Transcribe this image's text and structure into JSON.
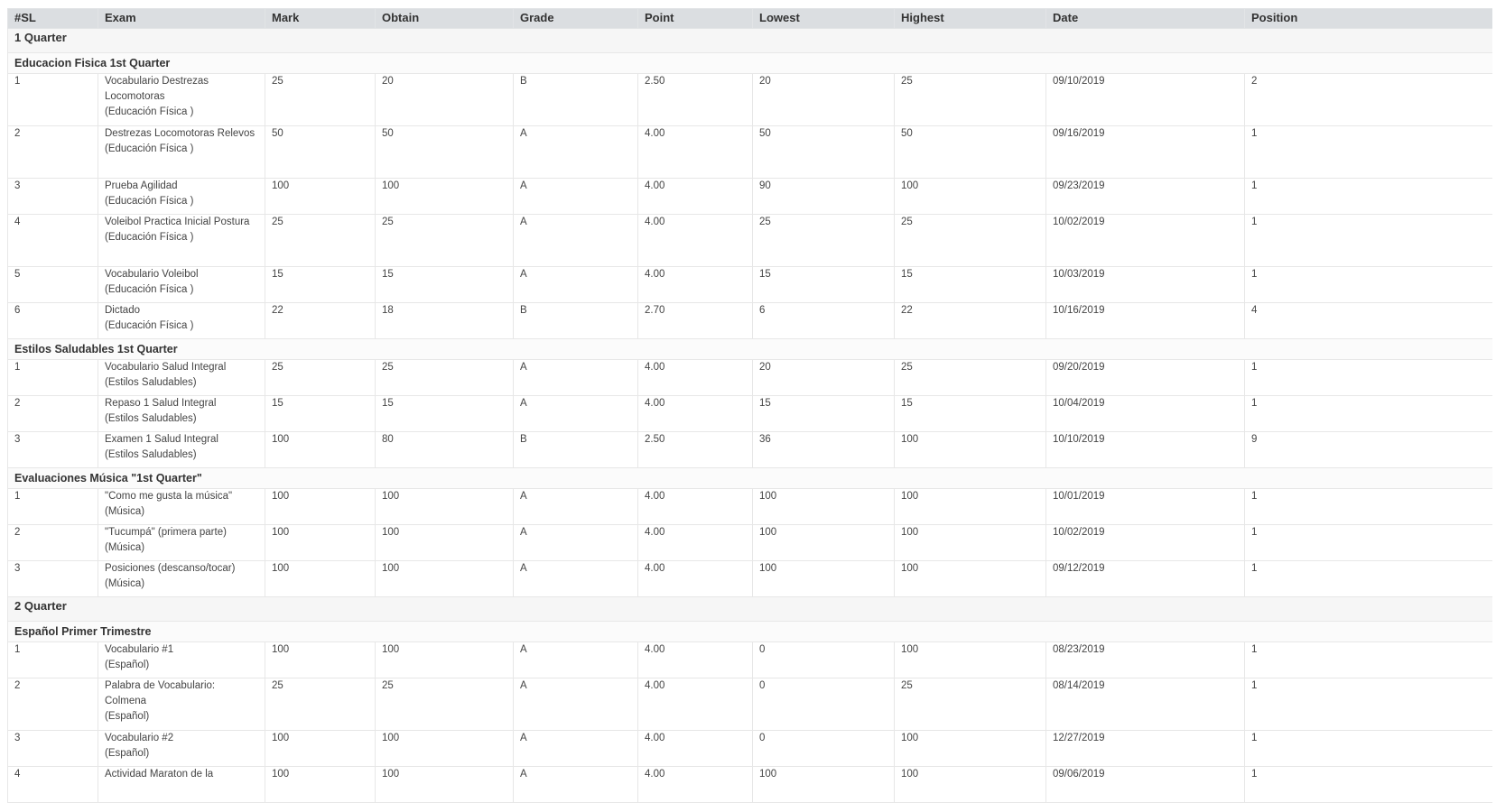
{
  "columns": [
    "#SL",
    "Exam",
    "Mark",
    "Obtain",
    "Grade",
    "Point",
    "Lowest",
    "Highest",
    "Date",
    "Position"
  ],
  "quarters": [
    {
      "label": "1 Quarter",
      "subjects": [
        {
          "label": "Educacion Fisica 1st Quarter",
          "rows": [
            {
              "sl": "1",
              "exam": "Vocabulario Destrezas Locomotoras",
              "subject": "(Educación Física )",
              "mark": "25",
              "obtain": "20",
              "grade": "B",
              "point": "2.50",
              "lowest": "20",
              "highest": "25",
              "date": "09/10/2019",
              "position": "2"
            },
            {
              "sl": "2",
              "exam": "Destrezas Locomotoras Relevos",
              "subject": "(Educación Física )",
              "mark": "50",
              "obtain": "50",
              "grade": "A",
              "point": "4.00",
              "lowest": "50",
              "highest": "50",
              "date": "09/16/2019",
              "position": "1"
            },
            {
              "sl": "3",
              "exam": "Prueba Agilidad",
              "subject": "(Educación Física )",
              "mark": "100",
              "obtain": "100",
              "grade": "A",
              "point": "4.00",
              "lowest": "90",
              "highest": "100",
              "date": "09/23/2019",
              "position": "1"
            },
            {
              "sl": "4",
              "exam": "Voleibol Practica Inicial Postura",
              "subject": "(Educación Física )",
              "mark": "25",
              "obtain": "25",
              "grade": "A",
              "point": "4.00",
              "lowest": "25",
              "highest": "25",
              "date": "10/02/2019",
              "position": "1"
            },
            {
              "sl": "5",
              "exam": "Vocabulario Voleibol",
              "subject": "(Educación Física )",
              "mark": "15",
              "obtain": "15",
              "grade": "A",
              "point": "4.00",
              "lowest": "15",
              "highest": "15",
              "date": "10/03/2019",
              "position": "1"
            },
            {
              "sl": "6",
              "exam": "Dictado",
              "subject": "(Educación Física )",
              "mark": "22",
              "obtain": "18",
              "grade": "B",
              "point": "2.70",
              "lowest": "6",
              "highest": "22",
              "date": "10/16/2019",
              "position": "4"
            }
          ]
        },
        {
          "label": "Estilos Saludables 1st Quarter",
          "rows": [
            {
              "sl": "1",
              "exam": "Vocabulario Salud Integral",
              "subject": "(Estilos Saludables)",
              "mark": "25",
              "obtain": "25",
              "grade": "A",
              "point": "4.00",
              "lowest": "20",
              "highest": "25",
              "date": "09/20/2019",
              "position": "1"
            },
            {
              "sl": "2",
              "exam": "Repaso 1 Salud Integral",
              "subject": "(Estilos Saludables)",
              "mark": "15",
              "obtain": "15",
              "grade": "A",
              "point": "4.00",
              "lowest": "15",
              "highest": "15",
              "date": "10/04/2019",
              "position": "1"
            },
            {
              "sl": "3",
              "exam": "Examen 1 Salud Integral",
              "subject": "(Estilos Saludables)",
              "mark": "100",
              "obtain": "80",
              "grade": "B",
              "point": "2.50",
              "lowest": "36",
              "highest": "100",
              "date": "10/10/2019",
              "position": "9"
            }
          ]
        },
        {
          "label": "Evaluaciones Música \"1st Quarter\"",
          "rows": [
            {
              "sl": "1",
              "exam": "\"Como me gusta la música\"",
              "subject": "(Música)",
              "mark": "100",
              "obtain": "100",
              "grade": "A",
              "point": "4.00",
              "lowest": "100",
              "highest": "100",
              "date": "10/01/2019",
              "position": "1"
            },
            {
              "sl": "2",
              "exam": "\"Tucumpá\" (primera parte)",
              "subject": "(Música)",
              "mark": "100",
              "obtain": "100",
              "grade": "A",
              "point": "4.00",
              "lowest": "100",
              "highest": "100",
              "date": "10/02/2019",
              "position": "1"
            },
            {
              "sl": "3",
              "exam": "Posiciones (descanso/tocar)",
              "subject": "(Música)",
              "mark": "100",
              "obtain": "100",
              "grade": "A",
              "point": "4.00",
              "lowest": "100",
              "highest": "100",
              "date": "09/12/2019",
              "position": "1"
            }
          ]
        }
      ]
    },
    {
      "label": "2 Quarter",
      "subjects": [
        {
          "label": "Español Primer Trimestre",
          "rows": [
            {
              "sl": "1",
              "exam": "Vocabulario #1",
              "subject": "(Español)",
              "mark": "100",
              "obtain": "100",
              "grade": "A",
              "point": "4.00",
              "lowest": "0",
              "highest": "100",
              "date": "08/23/2019",
              "position": "1"
            },
            {
              "sl": "2",
              "exam": "Palabra de Vocabulario: Colmena",
              "subject": "(Español)",
              "mark": "25",
              "obtain": "25",
              "grade": "A",
              "point": "4.00",
              "lowest": "0",
              "highest": "25",
              "date": "08/14/2019",
              "position": "1"
            },
            {
              "sl": "3",
              "exam": "Vocabulario #2",
              "subject": "(Español)",
              "mark": "100",
              "obtain": "100",
              "grade": "A",
              "point": "4.00",
              "lowest": "0",
              "highest": "100",
              "date": "12/27/2019",
              "position": "1"
            },
            {
              "sl": "4",
              "exam": "Actividad Maraton de la",
              "subject": "",
              "mark": "100",
              "obtain": "100",
              "grade": "A",
              "point": "4.00",
              "lowest": "100",
              "highest": "100",
              "date": "09/06/2019",
              "position": "1"
            }
          ]
        }
      ]
    }
  ]
}
